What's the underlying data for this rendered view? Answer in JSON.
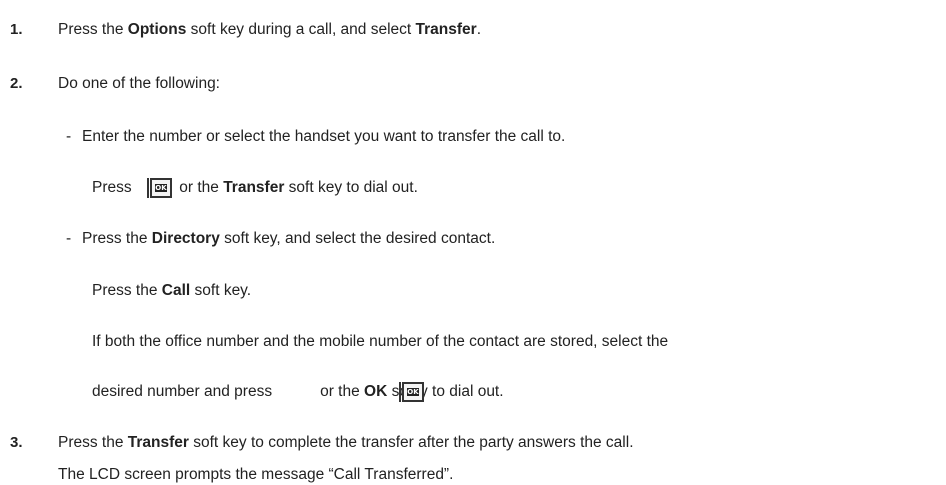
{
  "steps": [
    {
      "number": "1.",
      "text_a": "Press the ",
      "bold_a": "Options",
      "text_b": " soft key during a call, and select ",
      "bold_b": "Transfer",
      "text_c": "."
    },
    {
      "number": "2.",
      "text": "Do one of the following:",
      "option1": {
        "bullet": "-",
        "text": "Enter the number or select the handset you want to transfer the call to.",
        "sub_a": "Press ",
        "sub_b": " or the ",
        "sub_bold": "Transfer",
        "sub_c": " soft key to dial out."
      },
      "option2": {
        "bullet": "-",
        "text_a": "Press the ",
        "bold": "Directory",
        "text_b": " soft key, and select the desired contact.",
        "sub1_a": "Press the ",
        "sub1_bold": "Call",
        "sub1_b": " soft key.",
        "sub2": "If both the office number and the mobile number of the contact are stored, select the",
        "sub3_a": "desired number and press",
        "sub3_b": "or the ",
        "sub3_bold": "OK",
        "sub3_c": " so",
        "sub3_d": "y to dial out."
      }
    },
    {
      "number": "3.",
      "text_a": "Press the ",
      "bold": "Transfer",
      "text_b": " soft key to complete the transfer after the party answers the call.",
      "note": "The LCD screen prompts the message “Call Transferred”."
    }
  ],
  "ok_key_icon_label": "OK"
}
